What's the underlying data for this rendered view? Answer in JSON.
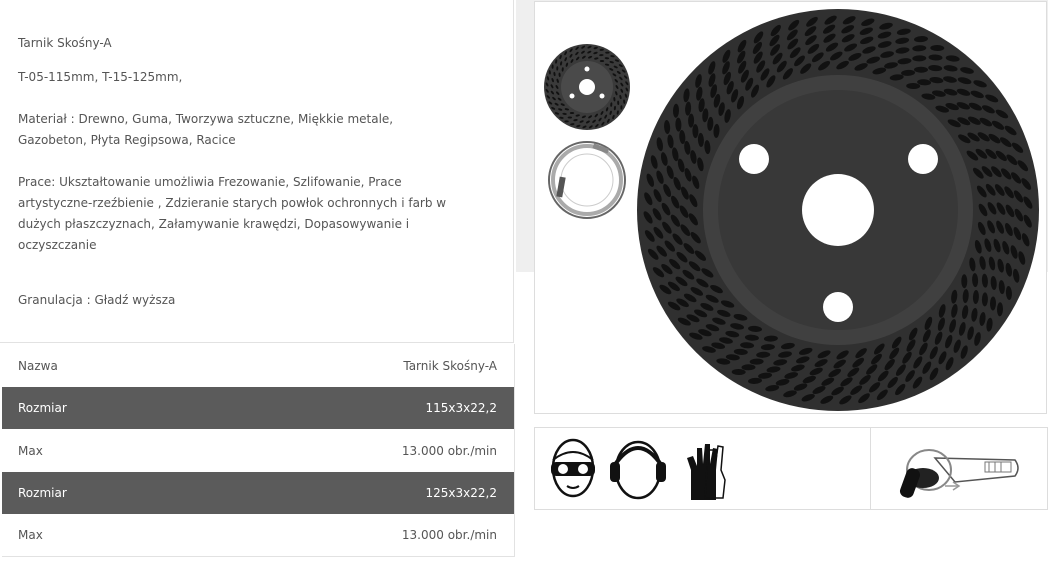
{
  "product": {
    "title": "Tarnik Skośny-A",
    "codes": "T-05-115mm, T-15-125mm,",
    "material_line1": "Materiał : Drewno, Guma, Tworzywa sztuczne, Miękkie metale,",
    "material_line2": "Gazobeton, Płyta Regipsowa, Racice",
    "work_line1": "Prace: Ukształtowanie umożliwia Frezowanie, Szlifowanie, Prace",
    "work_line2": "artystyczne-rzeźbienie , Zdzieranie starych powłok ochronnych i farb w",
    "work_line3": "dużych płaszczyznach, Załamywanie krawędzi, Dopasowywanie i",
    "work_line4": "oczyszczanie",
    "granulation": "Granulacja : Gładź wyższa"
  },
  "specs": [
    {
      "label": "Nazwa",
      "value": "Tarnik Skośny-A"
    },
    {
      "label": "Rozmiar",
      "value": "115x3x22,2"
    },
    {
      "label": "Max",
      "value": "13.000 obr./min"
    },
    {
      "label": "Rozmiar",
      "value": "125x3x22,2"
    },
    {
      "label": "Max",
      "value": "13.000 obr./min"
    }
  ],
  "colors": {
    "dark_row": "#5b5b5b",
    "text": "#555555",
    "disc": "#3a3a3a"
  },
  "icons": [
    "safety-goggles-icon",
    "ear-protection-icon",
    "gloves-icon",
    "angle-grinder-icon"
  ]
}
